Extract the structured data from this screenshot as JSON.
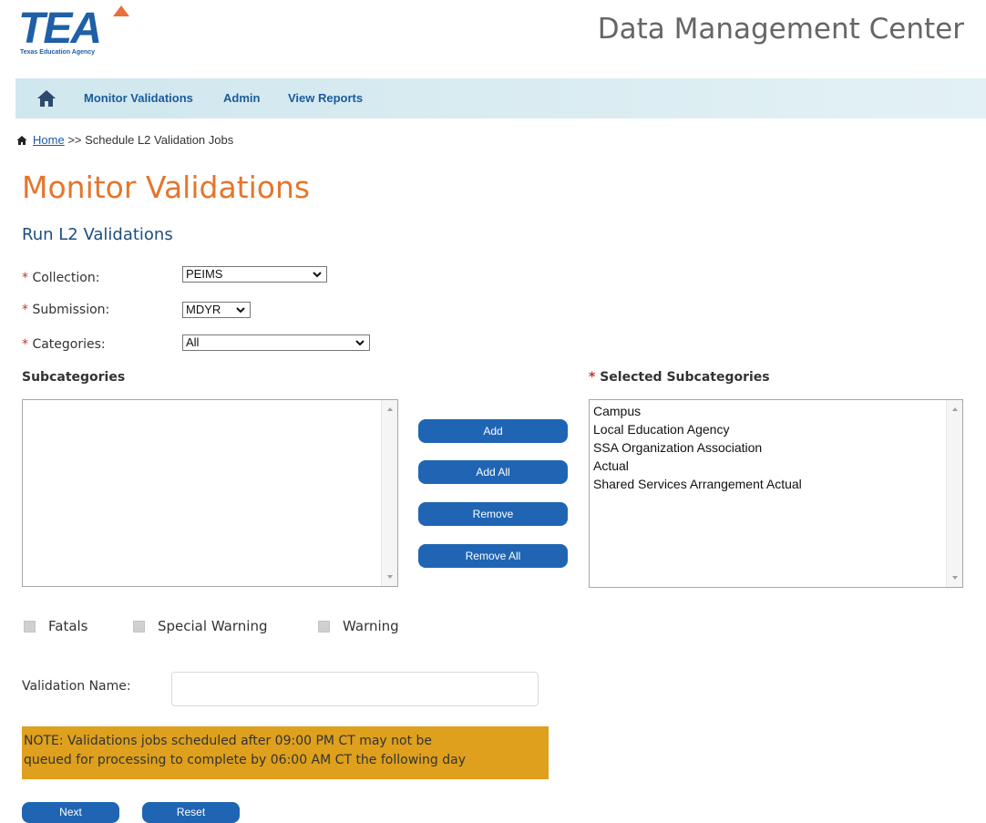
{
  "logo": {
    "brand": "TEA",
    "tagline": "Texas Education Agency"
  },
  "header": {
    "title": "Data Management Center"
  },
  "nav": {
    "home_icon": "home-icon",
    "items": [
      {
        "label": "Monitor Validations"
      },
      {
        "label": "Admin"
      },
      {
        "label": "View Reports"
      }
    ]
  },
  "breadcrumb": {
    "home": "Home",
    "separator": ">>",
    "current": "Schedule L2 Validation Jobs"
  },
  "page": {
    "title": "Monitor Validations",
    "section": "Run L2 Validations"
  },
  "form": {
    "required_marker": "*",
    "collection": {
      "label": "Collection:",
      "value": "PEIMS"
    },
    "submission": {
      "label": "Submission:",
      "value": "MDYR"
    },
    "categories": {
      "label": "Categories:",
      "value": "All"
    }
  },
  "subcategories": {
    "label": "Subcategories",
    "items": []
  },
  "selected_subcategories": {
    "label": "Selected Subcategories",
    "items": [
      "Campus",
      "Local Education Agency",
      "SSA Organization Association",
      "Actual",
      "Shared Services Arrangement Actual"
    ]
  },
  "buttons": {
    "add": "Add",
    "add_all": "Add All",
    "remove": "Remove",
    "remove_all": "Remove All",
    "next": "Next",
    "reset": "Reset"
  },
  "severity": {
    "fatals": {
      "label": "Fatals",
      "checked": false
    },
    "special_warning": {
      "label": "Special Warning",
      "checked": false
    },
    "warning": {
      "label": "Warning",
      "checked": false
    }
  },
  "validation_name": {
    "label": "Validation Name:",
    "value": ""
  },
  "note": {
    "line1": "NOTE: Validations jobs scheduled after 09:00 PM CT may not be",
    "line2": "queued for processing to complete by 06:00 AM CT the following day"
  },
  "colors": {
    "brand_blue": "#1f5fa8",
    "title_orange": "#e4762d",
    "button_blue": "#1f65b3",
    "note_bg": "#dea01d",
    "nav_bg": "#cfe7ee"
  }
}
